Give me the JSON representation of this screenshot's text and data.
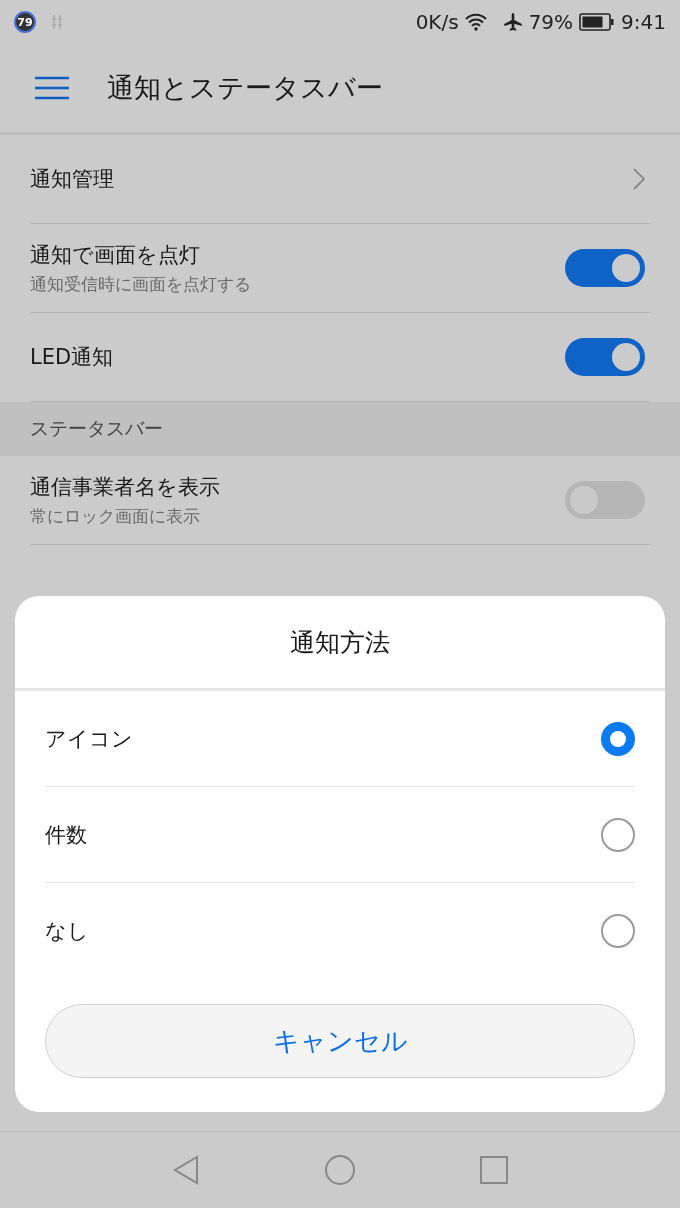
{
  "status_bar": {
    "badge": "79",
    "speed": "0K/s",
    "battery": "79%",
    "time": "9:41"
  },
  "app_bar": {
    "title": "通知とステータスバー"
  },
  "settings": [
    {
      "kind": "link",
      "label": "通知管理"
    },
    {
      "kind": "toggle",
      "label": "通知で画面を点灯",
      "subtitle": "通知受信時に画面を点灯する",
      "on": true
    },
    {
      "kind": "toggle",
      "label": "LED通知",
      "on": true
    },
    {
      "kind": "header",
      "label": "ステータスバー"
    },
    {
      "kind": "toggle",
      "label": "通信事業者名を表示",
      "subtitle": "常にロック画面に表示",
      "on": false
    }
  ],
  "dialog": {
    "title": "通知方法",
    "options": [
      {
        "label": "アイコン",
        "selected": true
      },
      {
        "label": "件数",
        "selected": false
      },
      {
        "label": "なし",
        "selected": false
      }
    ],
    "cancel": "キャンセル"
  }
}
